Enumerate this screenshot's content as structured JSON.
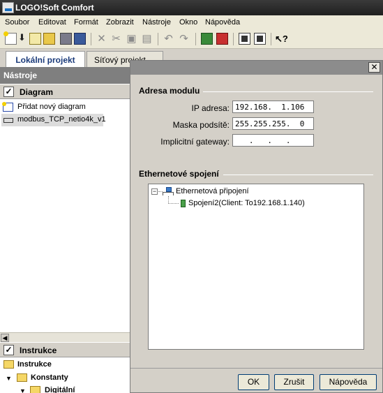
{
  "app": {
    "title": "LOGO!Soft Comfort",
    "logo_text": "LOGO"
  },
  "menu": [
    "Soubor",
    "Editovat",
    "Formát",
    "Zobrazit",
    "Nástroje",
    "Okno",
    "Nápověda"
  ],
  "toolbar": {
    "icons": [
      "new-diagram-icon",
      "download-icon",
      "import-icon",
      "open-folder-icon",
      "save-icon",
      "print-icon",
      "cut-icon",
      "scissors-icon",
      "copy-icon",
      "paste-icon",
      "undo-icon",
      "redo-icon",
      "pc-to-logo-icon",
      "logo-to-pc-icon",
      "online-test-icon",
      "screen-icon",
      "context-help-icon"
    ]
  },
  "tabs": {
    "local": "Lokální projekt",
    "network": "Síťový projekt"
  },
  "left_pane": {
    "tools_header": "Nástroje",
    "diagram_section": "Diagram",
    "diagram_items": [
      "Přidat nový diagram",
      "modbus_TCP_netio4k_v1"
    ],
    "instructions_section": "Instrukce",
    "tree": [
      {
        "label": "Instrukce",
        "level": 0
      },
      {
        "label": "Konstanty",
        "level": 1
      },
      {
        "label": "Digitální",
        "level": 2
      }
    ],
    "check_mark": "✓",
    "scroll_left": "◀"
  },
  "dialog": {
    "close_label": "✕",
    "module_group": "Adresa modulu",
    "fields": {
      "ip": {
        "label": "IP adresa:",
        "value": "192.168.  1.106"
      },
      "mask": {
        "label": "Maska podsítě:",
        "value": "255.255.255.  0"
      },
      "gateway": {
        "label": "Implicitní gateway:",
        "value": "   .   .   .   "
      }
    },
    "ethernet_group": "Ethernetové spojení",
    "tree": {
      "root": "Ethernetová připojení",
      "root_expander": "−",
      "child": "Spojení2(Client: To192.168.1.140)"
    },
    "buttons": {
      "ok": "OK",
      "cancel": "Zrušit",
      "help": "Nápověda"
    }
  }
}
